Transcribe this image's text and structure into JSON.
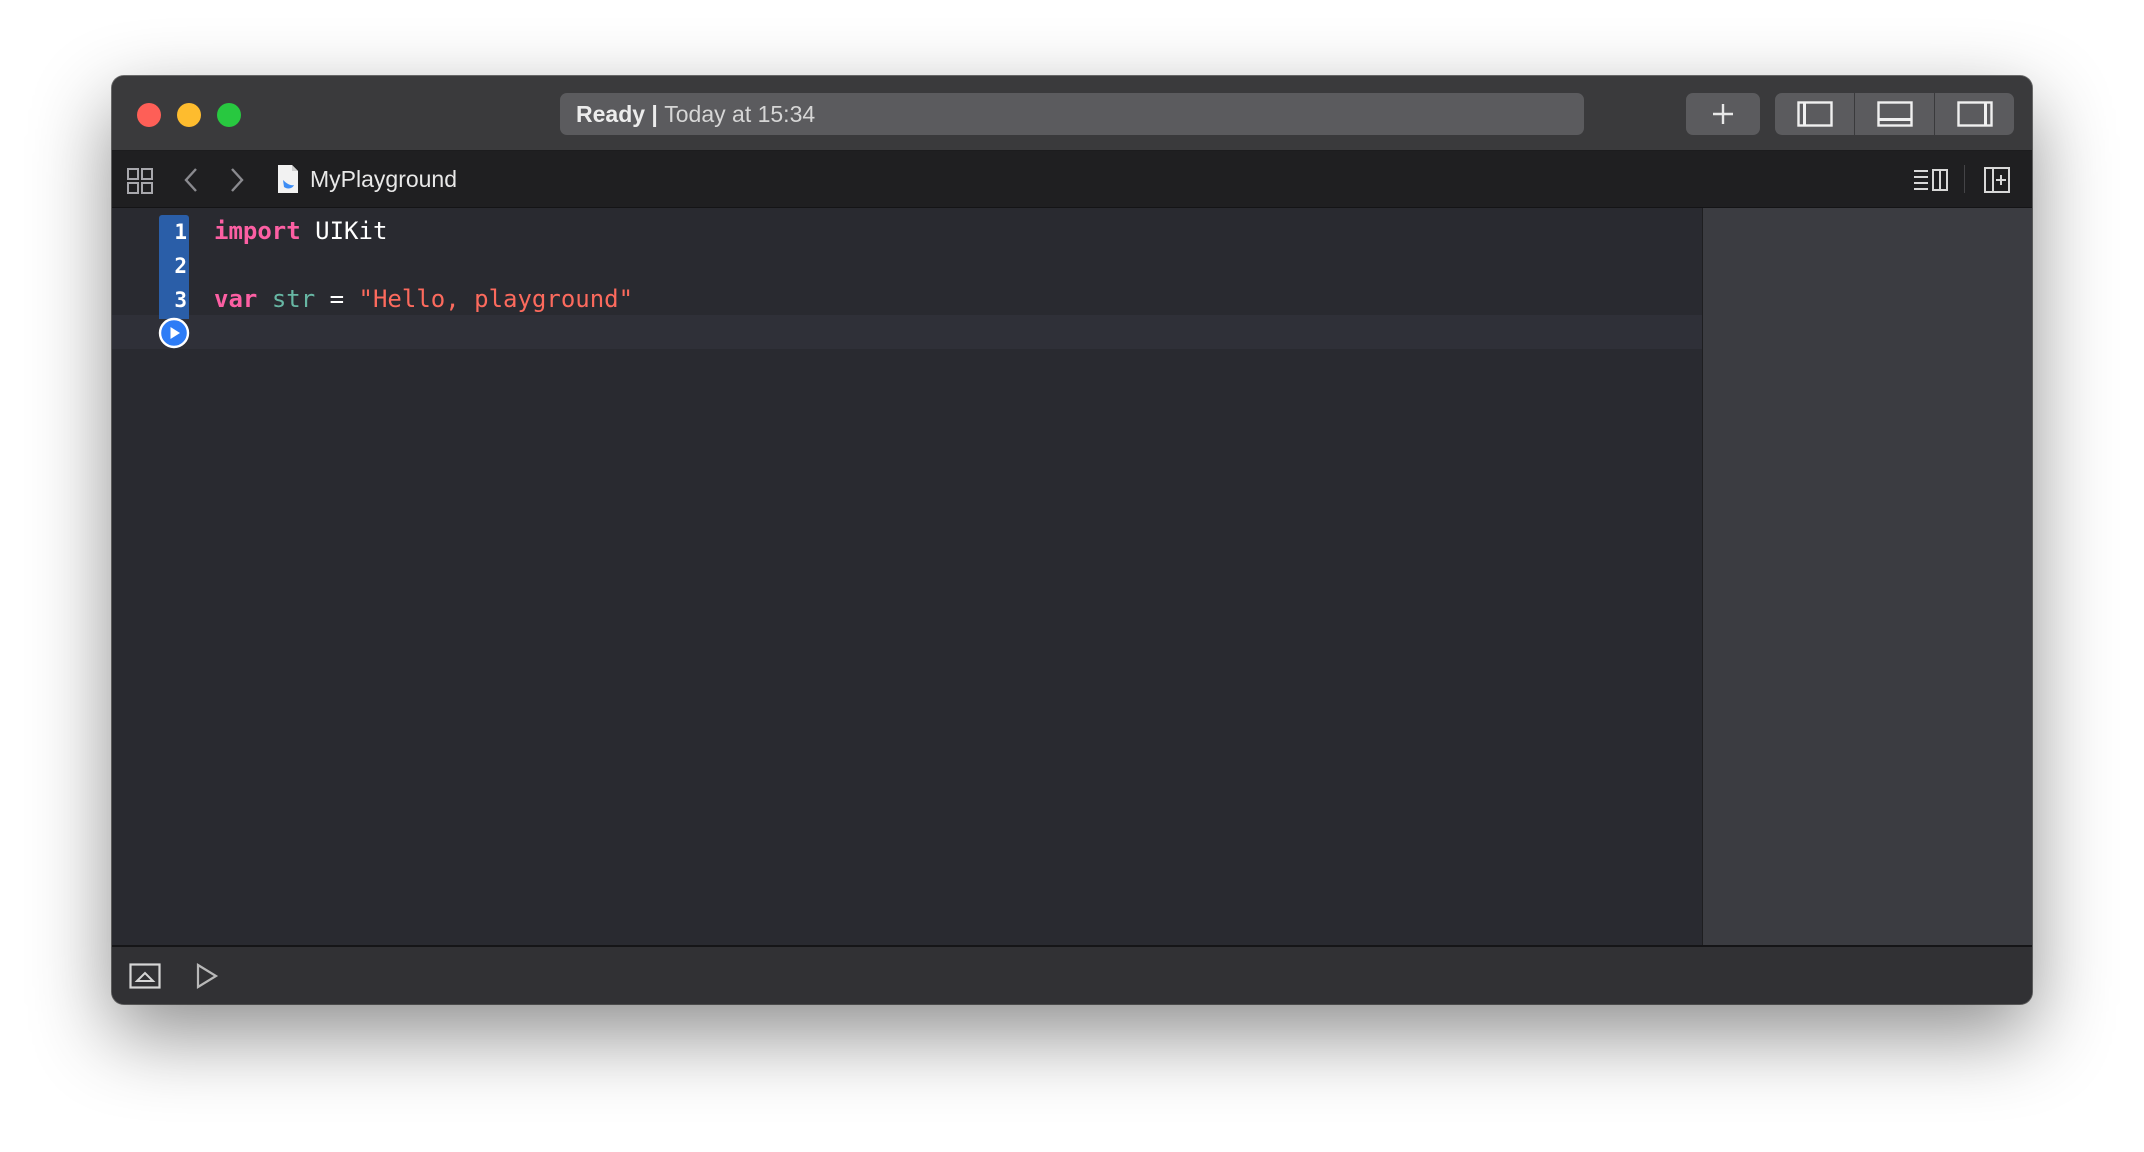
{
  "toolbar": {
    "activity_status": "Ready",
    "activity_separator": " | ",
    "activity_time": "Today at 15:34",
    "add_button_icon": "plus-icon",
    "layout_buttons": [
      "show-navigator-icon",
      "show-debug-area-icon",
      "show-inspector-icon"
    ]
  },
  "jumpbar": {
    "file_name": "MyPlayground",
    "left_icons": [
      "related-items-grid-icon",
      "chevron-left-icon",
      "chevron-right-icon",
      "swift-file-icon"
    ],
    "right_icons": [
      "editor-options-icon",
      "add-editor-icon"
    ]
  },
  "editor": {
    "line_numbers": [
      "1",
      "2",
      "3"
    ],
    "lines": {
      "l1_keyword": "import",
      "l1_rest": " UIKit",
      "l3_keyword": "var",
      "l3_ident": "str",
      "l3_op": " = ",
      "l3_string": "\"Hello, playground\""
    },
    "run_icon": "play-circle-icon"
  },
  "bottom": {
    "icons": [
      "toggle-console-icon",
      "run-playground-icon"
    ]
  },
  "colors": {
    "window_bg": "#292a30",
    "keyword": "#fc5fa3",
    "identifier": "#67b7a4",
    "string": "#fc6a5d",
    "gutter_accent": "#2a5ea8",
    "close": "#fe5f57",
    "minimize": "#febc2e",
    "maximize": "#28c840"
  }
}
